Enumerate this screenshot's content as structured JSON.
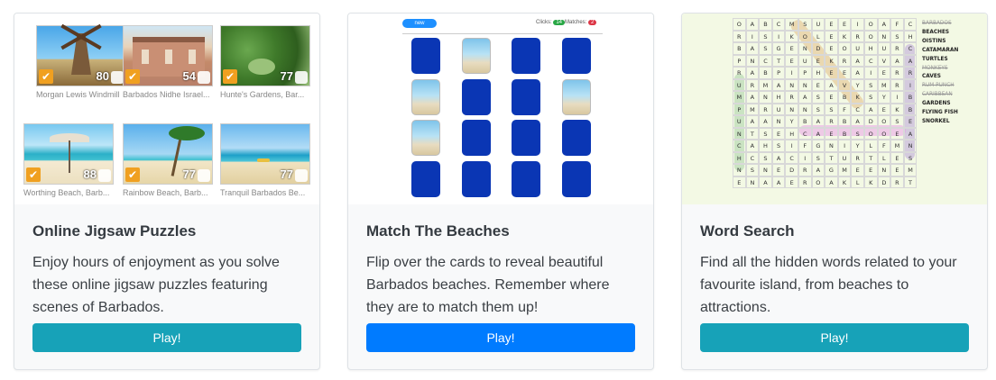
{
  "cards": [
    {
      "title": "Online Jigsaw Puzzles",
      "description": "Enjoy hours of enjoyment as you solve these online jigsaw puzzles featuring scenes of Barbados.",
      "button": "Play!",
      "button_color": "#17a2b8",
      "puzzles": [
        {
          "caption": "Morgan Lewis Windmill",
          "pieces": "80"
        },
        {
          "caption": "Barbados Nidhe Israel...",
          "pieces": "54"
        },
        {
          "caption": "Hunte's Gardens, Bar...",
          "pieces": "77"
        },
        {
          "caption": "Worthing Beach, Barb...",
          "pieces": "88"
        },
        {
          "caption": "Rainbow Beach, Barb...",
          "pieces": "77"
        },
        {
          "caption": "Tranquil Barbados Be...",
          "pieces": "77"
        }
      ]
    },
    {
      "title": "Match The Beaches",
      "description": "Flip over the cards to reveal beautiful Barbados beaches. Remember where they are to match them up!",
      "button": "Play!",
      "button_color": "#007bff",
      "memory": {
        "new_label": "new",
        "clicks_label": "Clicks:",
        "clicks": "14",
        "matches_label": "Matches:",
        "matches": "2"
      }
    },
    {
      "title": "Word Search",
      "description": "Find all the hidden words related to your favourite island, from beaches to attractions.",
      "button": "Play!",
      "button_color": "#17a2b8",
      "wordsearch": {
        "rows": [
          "OABCMSUEEIOAFC",
          "RISIKOLEKRONSH",
          "BASGENDEOUHURC",
          "PNCTEUEKRACVAA",
          "RABPIPHEEAIERR",
          "URMANNEAVYSMRI",
          "MANHRASEBKSYIB",
          "PMRUNNSSFCAEKB",
          "UAANYBARBADOSE",
          "NTSEHCAEBSOOEA",
          "CAHSIFGNIYLFMN",
          "HCSACISTURTLES",
          "NSNEDRAGMEENEM",
          "ENAAEROAKLKDRT"
        ],
        "words": [
          {
            "text": "BARBADOS",
            "found": true
          },
          {
            "text": "BEACHES",
            "found": false
          },
          {
            "text": "OISTINS",
            "found": false
          },
          {
            "text": "CATAMARAN",
            "found": false
          },
          {
            "text": "TURTLES",
            "found": false
          },
          {
            "text": "MONKEYS",
            "found": true
          },
          {
            "text": "CAVES",
            "found": false
          },
          {
            "text": "RUM PUNCH",
            "found": true
          },
          {
            "text": "CARIBBEAN",
            "found": true
          },
          {
            "text": "GARDENS",
            "found": false
          },
          {
            "text": "FLYING FISH",
            "found": false
          },
          {
            "text": "SNORKEL",
            "found": false
          }
        ]
      }
    }
  ]
}
